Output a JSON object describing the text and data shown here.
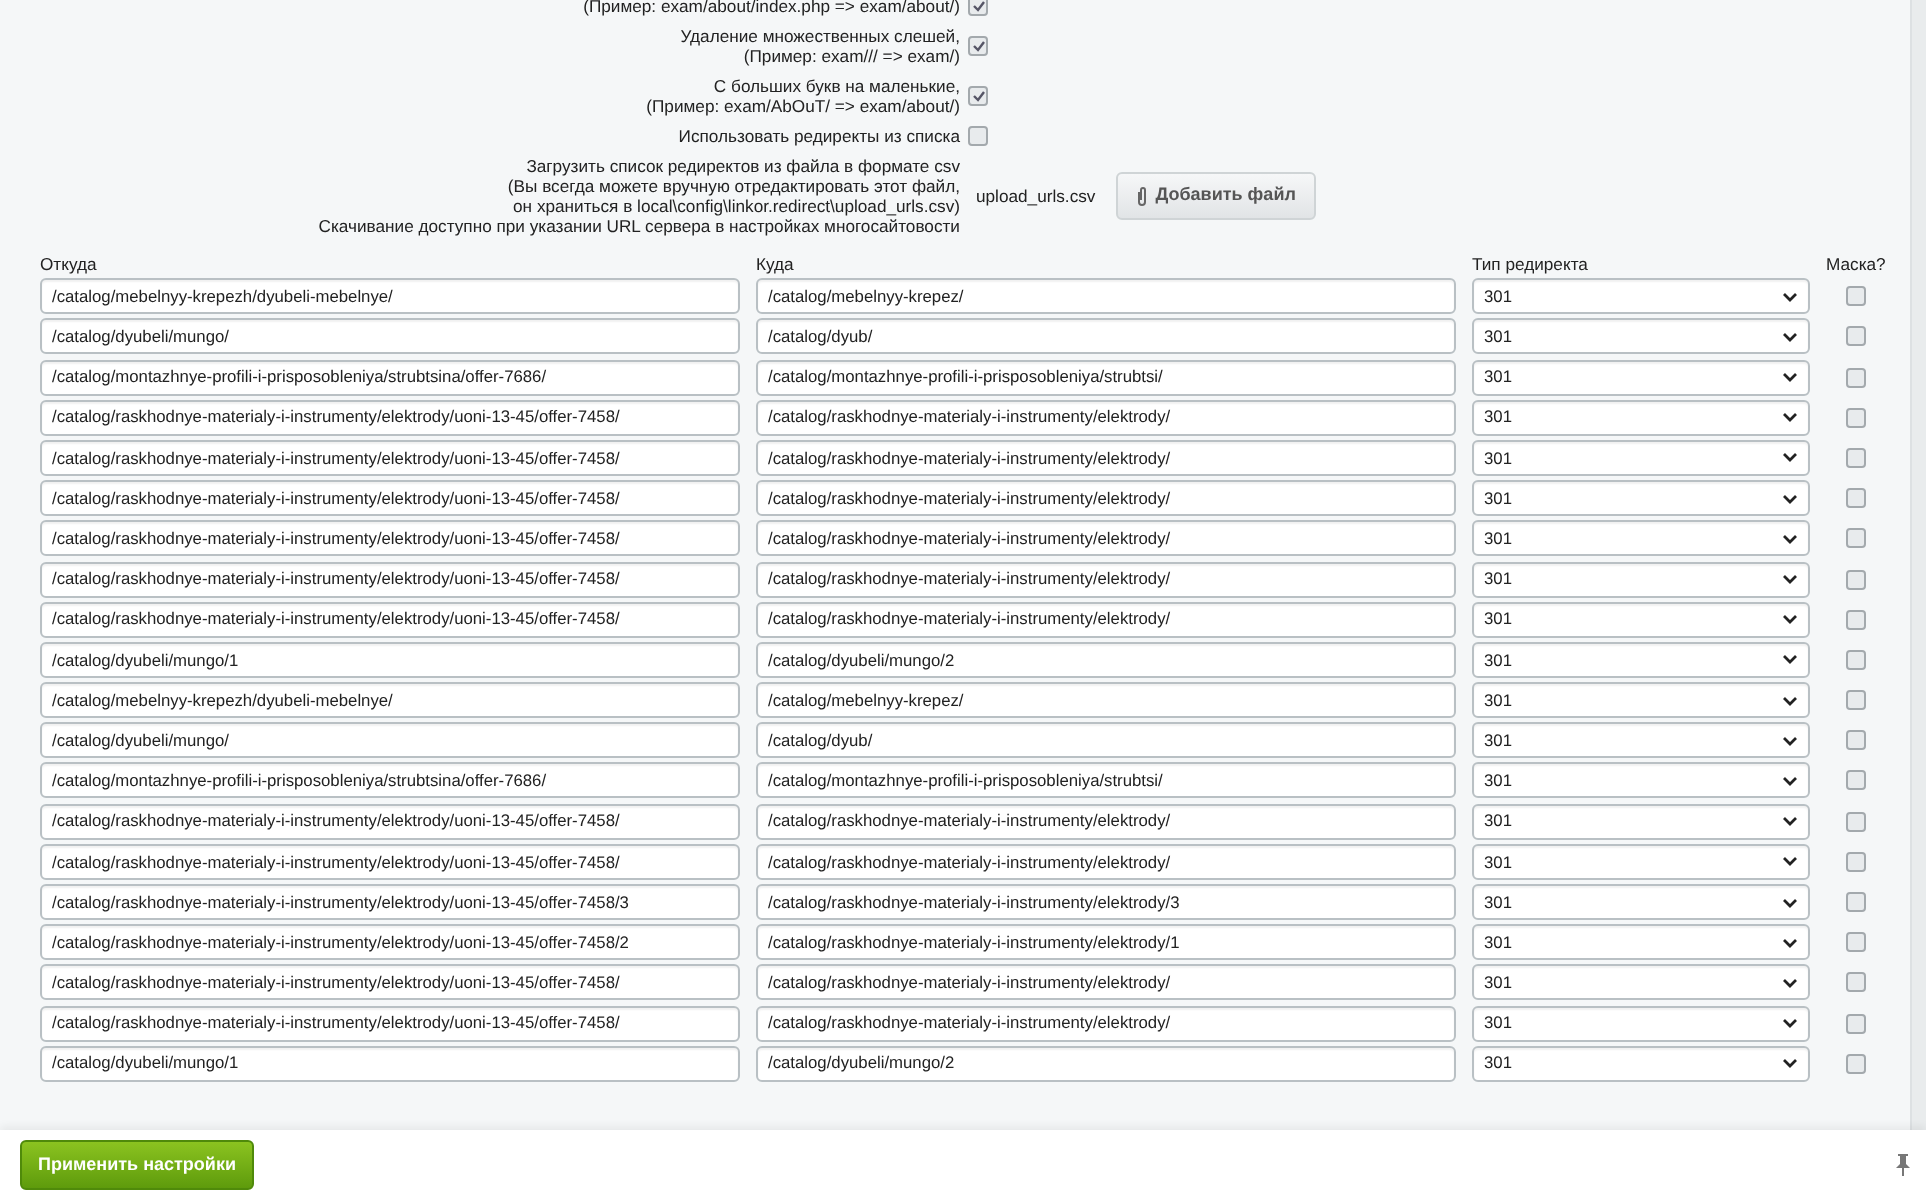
{
  "options": [
    {
      "kind": "checkbox",
      "lines": [
        "(Пример: exam/about/index.php => exam/about/)"
      ],
      "checked": true
    },
    {
      "kind": "checkbox",
      "lines": [
        "Удаление множественных слешей,",
        "(Пример: exam/// => exam/)"
      ],
      "checked": true
    },
    {
      "kind": "checkbox",
      "lines": [
        "С больших букв на маленькие,",
        "(Пример: exam/AbOuT/ => exam/about/)"
      ],
      "checked": true
    },
    {
      "kind": "checkbox",
      "lines": [
        "Использовать редиректы из списка"
      ],
      "checked": false
    },
    {
      "kind": "file",
      "lines": [
        "Загрузить список редиректов из файла в формате csv",
        "(Вы всегда можете вручную отредактировать этот файл,",
        "он храниться в local\\config\\linkor.redirect\\upload_urls.csv)",
        "Скачивание доступно при указании URL сервера в настройках многосайтовости"
      ],
      "file_name": "upload_urls.csv",
      "button": "Добавить файл"
    }
  ],
  "table": {
    "columns": [
      "Откуда",
      "Куда",
      "Тип редиректа",
      "Маска?"
    ],
    "rows": [
      {
        "from": "/catalog/mebelnyy-krepezh/dyubeli-mebelnye/",
        "to": "/catalog/mebelnyy-krepez/",
        "type": "301",
        "mask": false
      },
      {
        "from": "/catalog/dyubeli/mungo/",
        "to": "/catalog/dyub/",
        "type": "301",
        "mask": false
      },
      {
        "from": "/catalog/montazhnye-profili-i-prisposobleniya/strubtsina/offer-7686/",
        "to": "/catalog/montazhnye-profili-i-prisposobleniya/strubtsi/",
        "type": "301",
        "mask": false
      },
      {
        "from": "/catalog/raskhodnye-materialy-i-instrumenty/elektrody/uoni-13-45/offer-7458/",
        "to": "/catalog/raskhodnye-materialy-i-instrumenty/elektrody/",
        "type": "301",
        "mask": false
      },
      {
        "from": "/catalog/raskhodnye-materialy-i-instrumenty/elektrody/uoni-13-45/offer-7458/",
        "to": "/catalog/raskhodnye-materialy-i-instrumenty/elektrody/",
        "type": "301",
        "mask": false
      },
      {
        "from": "/catalog/raskhodnye-materialy-i-instrumenty/elektrody/uoni-13-45/offer-7458/",
        "to": "/catalog/raskhodnye-materialy-i-instrumenty/elektrody/",
        "type": "301",
        "mask": false
      },
      {
        "from": "/catalog/raskhodnye-materialy-i-instrumenty/elektrody/uoni-13-45/offer-7458/",
        "to": "/catalog/raskhodnye-materialy-i-instrumenty/elektrody/",
        "type": "301",
        "mask": false
      },
      {
        "from": "/catalog/raskhodnye-materialy-i-instrumenty/elektrody/uoni-13-45/offer-7458/",
        "to": "/catalog/raskhodnye-materialy-i-instrumenty/elektrody/",
        "type": "301",
        "mask": false
      },
      {
        "from": "/catalog/raskhodnye-materialy-i-instrumenty/elektrody/uoni-13-45/offer-7458/",
        "to": "/catalog/raskhodnye-materialy-i-instrumenty/elektrody/",
        "type": "301",
        "mask": false
      },
      {
        "from": "/catalog/dyubeli/mungo/1",
        "to": "/catalog/dyubeli/mungo/2",
        "type": "301",
        "mask": false
      },
      {
        "from": "/catalog/mebelnyy-krepezh/dyubeli-mebelnye/",
        "to": "/catalog/mebelnyy-krepez/",
        "type": "301",
        "mask": false
      },
      {
        "from": "/catalog/dyubeli/mungo/",
        "to": "/catalog/dyub/",
        "type": "301",
        "mask": false
      },
      {
        "from": "/catalog/montazhnye-profili-i-prisposobleniya/strubtsina/offer-7686/",
        "to": "/catalog/montazhnye-profili-i-prisposobleniya/strubtsi/",
        "type": "301",
        "mask": false
      },
      {
        "from": "/catalog/raskhodnye-materialy-i-instrumenty/elektrody/uoni-13-45/offer-7458/",
        "to": "/catalog/raskhodnye-materialy-i-instrumenty/elektrody/",
        "type": "301",
        "mask": false
      },
      {
        "from": "/catalog/raskhodnye-materialy-i-instrumenty/elektrody/uoni-13-45/offer-7458/",
        "to": "/catalog/raskhodnye-materialy-i-instrumenty/elektrody/",
        "type": "301",
        "mask": false
      },
      {
        "from": "/catalog/raskhodnye-materialy-i-instrumenty/elektrody/uoni-13-45/offer-7458/3",
        "to": "/catalog/raskhodnye-materialy-i-instrumenty/elektrody/3",
        "type": "301",
        "mask": false
      },
      {
        "from": "/catalog/raskhodnye-materialy-i-instrumenty/elektrody/uoni-13-45/offer-7458/2",
        "to": "/catalog/raskhodnye-materialy-i-instrumenty/elektrody/1",
        "type": "301",
        "mask": false
      },
      {
        "from": "/catalog/raskhodnye-materialy-i-instrumenty/elektrody/uoni-13-45/offer-7458/",
        "to": "/catalog/raskhodnye-materialy-i-instrumenty/elektrody/",
        "type": "301",
        "mask": false
      },
      {
        "from": "/catalog/raskhodnye-materialy-i-instrumenty/elektrody/uoni-13-45/offer-7458/",
        "to": "/catalog/raskhodnye-materialy-i-instrumenty/elektrody/",
        "type": "301",
        "mask": false
      },
      {
        "from": "/catalog/dyubeli/mungo/1",
        "to": "/catalog/dyubeli/mungo/2",
        "type": "301",
        "mask": false
      }
    ]
  },
  "footer": {
    "apply_button": "Применить настройки"
  }
}
